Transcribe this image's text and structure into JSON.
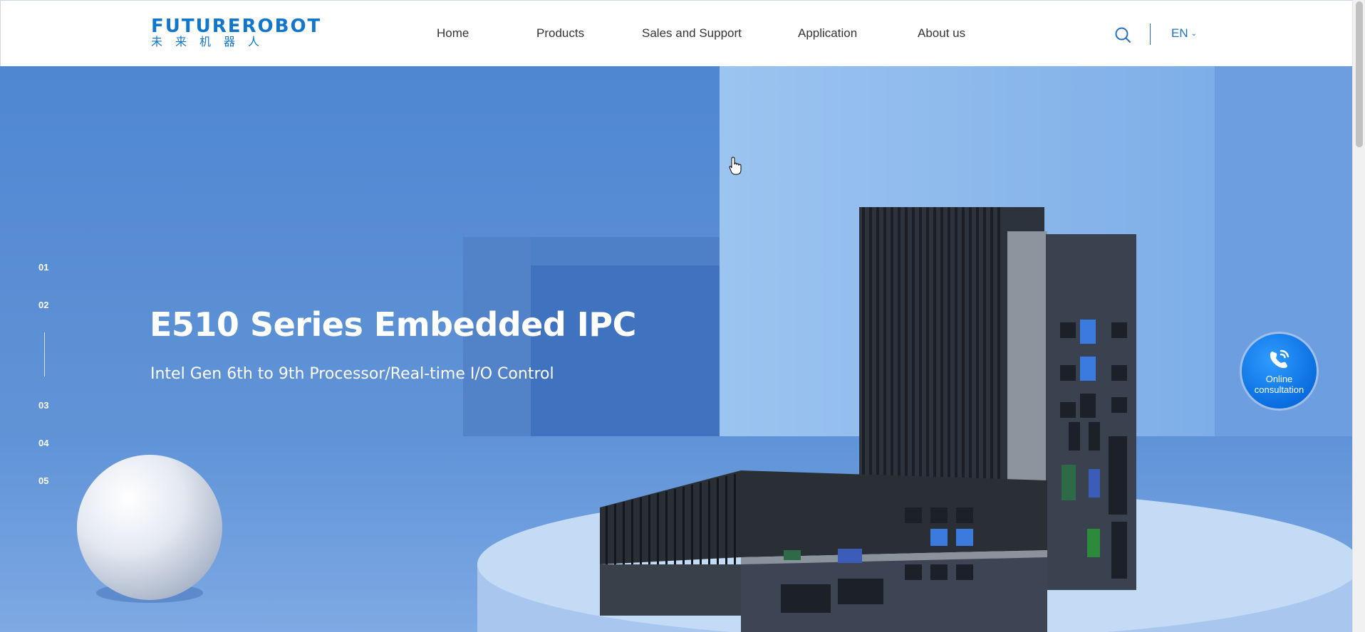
{
  "header": {
    "logo_text": "FUTUREROBOT",
    "logo_cn": "未来机器人",
    "nav": [
      "Home",
      "Products",
      "Sales and Support",
      "Application",
      "About us"
    ],
    "lang": "EN"
  },
  "hero": {
    "title": "E510 Series Embedded IPC",
    "subtitle": "Intel Gen 6th to 9th Processor/Real-time I/O Control",
    "slides": [
      "01",
      "02",
      "03",
      "04",
      "05"
    ],
    "active_slide": "02"
  },
  "consult": {
    "line1": "Online",
    "line2": "consultation"
  },
  "colors": {
    "brand": "#1277cc",
    "hero_bg": "#5a8fd6",
    "consult": "#0a6ee0"
  }
}
